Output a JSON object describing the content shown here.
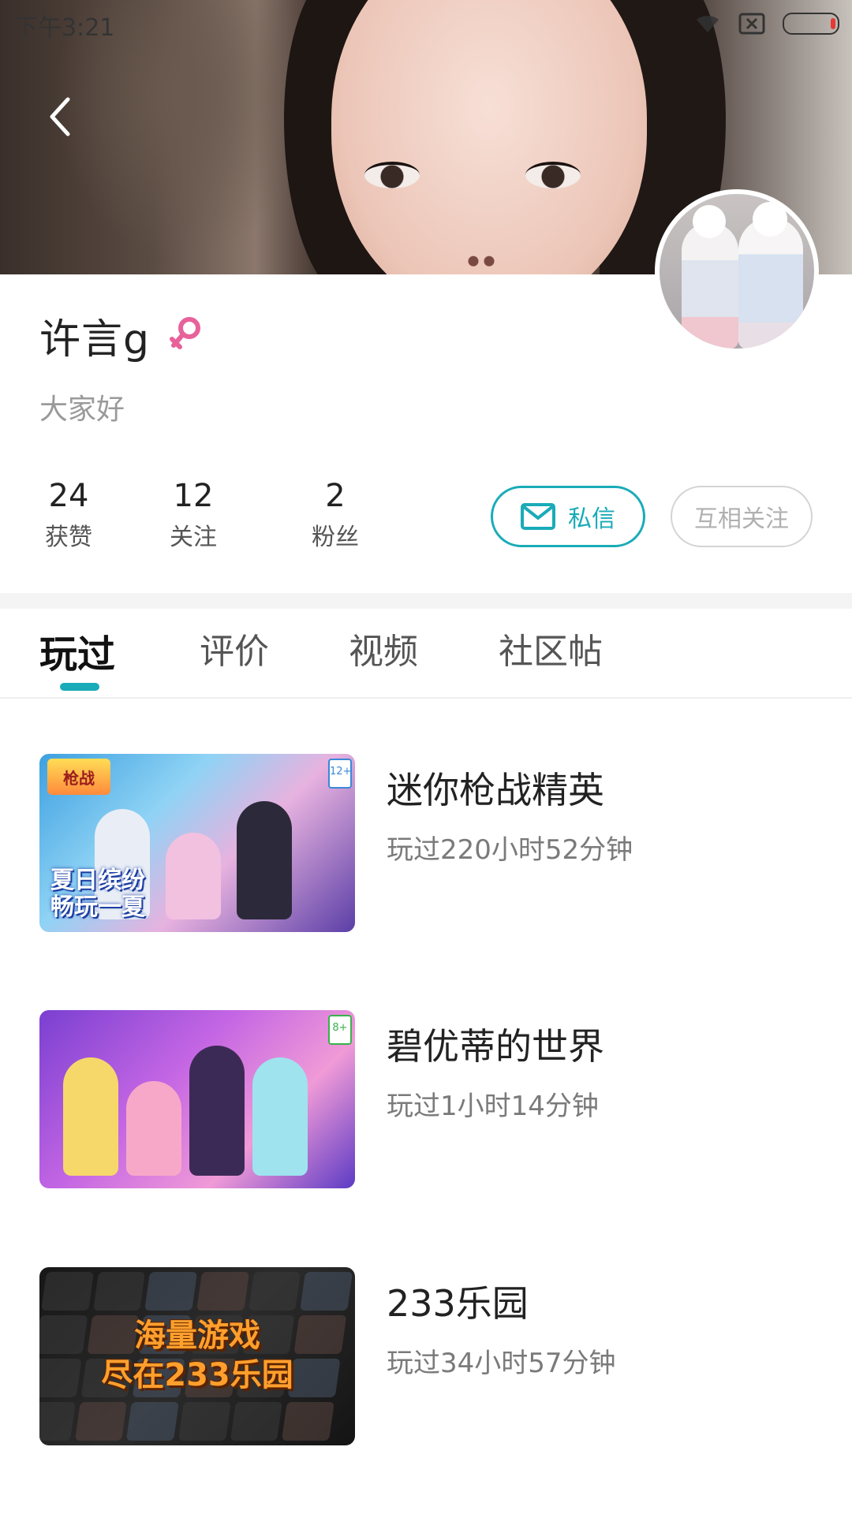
{
  "status_bar": {
    "time": "下午3:21"
  },
  "profile": {
    "username": "许言g",
    "bio": "大家好",
    "stats": [
      {
        "value": "24",
        "label": "获赞"
      },
      {
        "value": "12",
        "label": "关注"
      },
      {
        "value": "2",
        "label": "粉丝"
      }
    ],
    "message_button": "私信",
    "mutual_follow_button": "互相关注"
  },
  "tabs": [
    {
      "label": "玩过",
      "active": true
    },
    {
      "label": "评价",
      "active": false
    },
    {
      "label": "视频",
      "active": false
    },
    {
      "label": "社区帖",
      "active": false
    }
  ],
  "games": [
    {
      "title": "迷你枪战精英",
      "playtime": "玩过220小时52分钟",
      "thumb_caption": "夏日缤纷\n畅玩一夏",
      "age_badge": "12+"
    },
    {
      "title": "碧优蒂的世界",
      "playtime": "玩过1小时14分钟",
      "age_badge": "8+"
    },
    {
      "title": "233乐园",
      "playtime": "玩过34小时57分钟",
      "thumb_text_1": "海量游戏",
      "thumb_text_2": "尽在233乐园"
    }
  ],
  "colors": {
    "accent": "#1aabb8",
    "gender": "#e8629a"
  }
}
